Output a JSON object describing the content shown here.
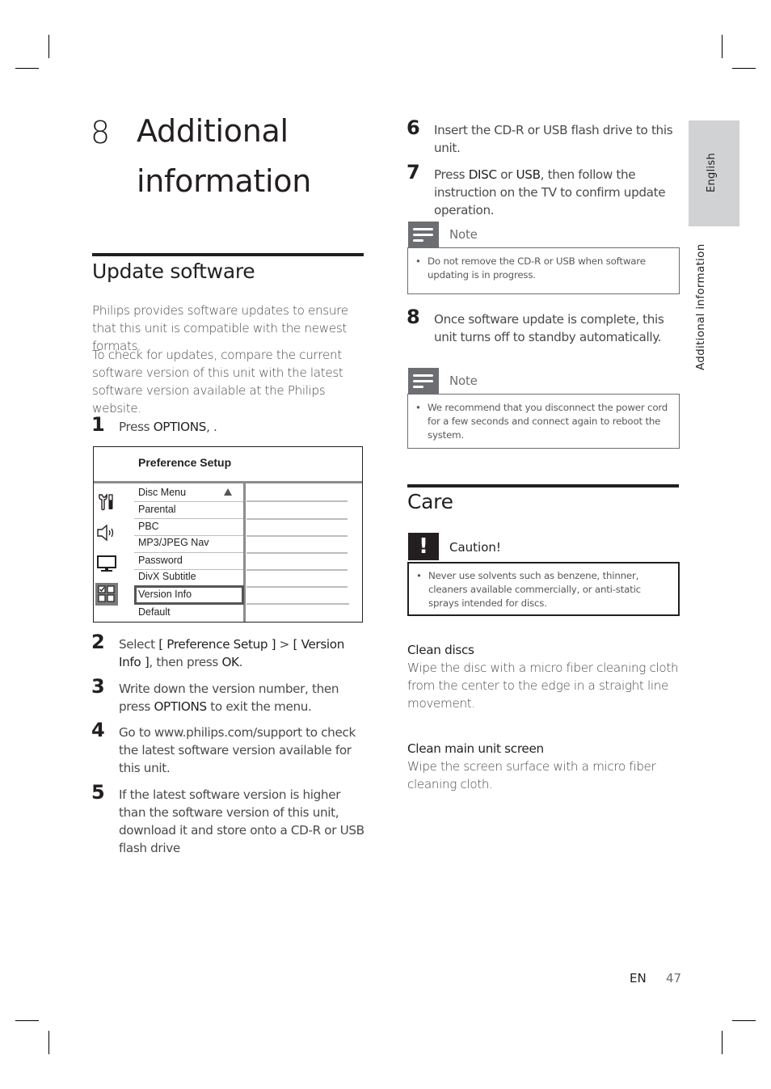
{
  "chapter": {
    "number": "8",
    "title_line1": "Additional",
    "title_line2": "information"
  },
  "update_section": {
    "heading": "Update software",
    "para1": "Philips provides software updates to ensure that this unit is compatible with the newest formats.",
    "para2": "To check for updates, compare the current software version of this unit with the latest software version available at the Philips website.",
    "steps": [
      {
        "num": "1",
        "pre": "Press ",
        "bold1": "OPTIONS",
        "mid": ", .",
        "bold2": "",
        "post": ""
      },
      {
        "num": "2",
        "pre": "Select ",
        "bold1": "[ Preference Setup ]",
        "mid": " > ",
        "bold2": "[ Version Info ]",
        "post": ", then press ",
        "bold3": "OK",
        "end": "."
      },
      {
        "num": "3",
        "pre": "Write down the version number, then press ",
        "bold1": "OPTIONS",
        "post": " to exit the menu."
      },
      {
        "num": "4",
        "text": "Go to www.philips.com/support to check the latest software version available for this unit."
      },
      {
        "num": "5",
        "text": "If the latest software version is higher than the software version of this unit, download it and store onto a CD-R or USB flash drive"
      },
      {
        "num": "6",
        "text": "Insert the CD-R or USB flash drive to this unit."
      },
      {
        "num": "7",
        "pre": "Press ",
        "bold1": "DISC",
        "mid": " or ",
        "bold2": "USB",
        "post": ", then follow the instruction on the TV to confirm update operation."
      },
      {
        "num": "8",
        "text": "Once software update is complete, this unit turns off to standby automatically."
      }
    ],
    "menu": {
      "title": "Preference Setup",
      "items": [
        "Disc Menu",
        "Parental",
        "PBC",
        "MP3/JPEG Nav",
        "Password",
        "DivX Subtitle",
        "Version Info",
        "Default"
      ],
      "selected": "Version Info",
      "icons": [
        "general-setup-icon",
        "audio-setup-icon",
        "video-setup-icon",
        "preference-setup-icon"
      ]
    },
    "note1": {
      "label": "Note",
      "text": "Do not remove the CD-R or USB when software updating is in progress."
    },
    "note2": {
      "label": "Note",
      "text": "We recommend that you disconnect the power cord for a few seconds and connect again to reboot the system."
    }
  },
  "care_section": {
    "heading": "Care",
    "caution": {
      "label": "Caution!",
      "symbol": "!",
      "text": "Never use solvents such as benzene, thinner, cleaners available commercially, or anti-static sprays intended for discs."
    },
    "clean_discs": {
      "title": "Clean discs",
      "text": "Wipe the disc with a micro fiber cleaning cloth from the center to the edge in a straight line movement."
    },
    "clean_screen": {
      "title": "Clean main unit screen",
      "text": "Wipe the screen surface with a micro fiber cleaning cloth."
    }
  },
  "side_tabs": {
    "language": "English",
    "section": "Additional information"
  },
  "footer": {
    "lang": "EN",
    "page": "47"
  }
}
